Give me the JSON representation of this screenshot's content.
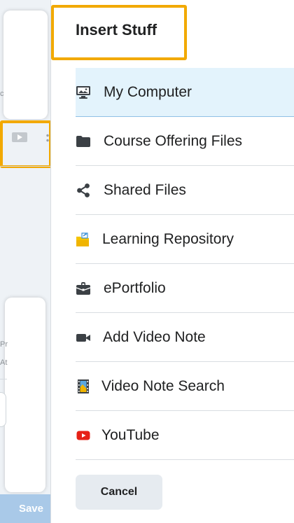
{
  "dialog": {
    "title": "Insert Stuff",
    "items": [
      {
        "label": "My Computer",
        "icon": "computer-icon",
        "selected": true
      },
      {
        "label": "Course Offering Files",
        "icon": "folder-icon"
      },
      {
        "label": "Shared Files",
        "icon": "share-icon"
      },
      {
        "label": "Learning Repository",
        "icon": "repository-icon"
      },
      {
        "label": "ePortfolio",
        "icon": "briefcase-icon"
      },
      {
        "label": "Add Video Note",
        "icon": "video-camera-icon"
      },
      {
        "label": "Video Note Search",
        "icon": "film-icon"
      },
      {
        "label": "YouTube",
        "icon": "youtube-icon"
      }
    ],
    "cancel_label": "Cancel"
  },
  "background": {
    "save_label": "Save",
    "fragment_c": "c",
    "fragment_pr": "Pr",
    "fragment_at": "At"
  },
  "colors": {
    "highlight": "#f2a900",
    "selected_bg": "#e3f3fc",
    "youtube_red": "#e62117",
    "repository_yellow": "#f5c400",
    "repository_blue": "#3a8fd6"
  }
}
